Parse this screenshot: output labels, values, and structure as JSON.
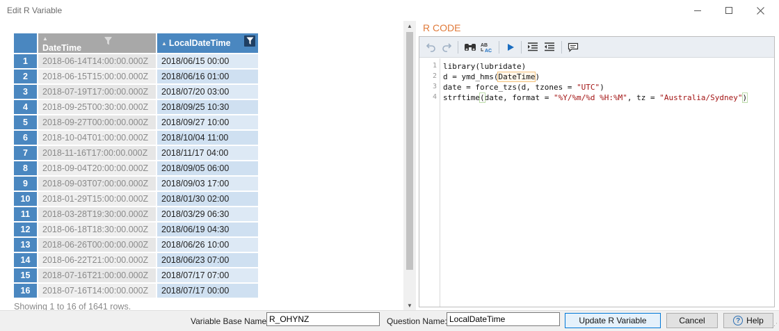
{
  "window": {
    "title": "Edit R Variable"
  },
  "table": {
    "headers": {
      "datetime": "DateTime",
      "localdatetime": "LocalDateTime"
    },
    "rows": [
      {
        "n": "1",
        "dt": "2018-06-14T14:00:00.000Z",
        "ldt": "2018/06/15 00:00"
      },
      {
        "n": "2",
        "dt": "2018-06-15T15:00:00.000Z",
        "ldt": "2018/06/16 01:00"
      },
      {
        "n": "3",
        "dt": "2018-07-19T17:00:00.000Z",
        "ldt": "2018/07/20 03:00"
      },
      {
        "n": "4",
        "dt": "2018-09-25T00:30:00.000Z",
        "ldt": "2018/09/25 10:30"
      },
      {
        "n": "5",
        "dt": "2018-09-27T00:00:00.000Z",
        "ldt": "2018/09/27 10:00"
      },
      {
        "n": "6",
        "dt": "2018-10-04T01:00:00.000Z",
        "ldt": "2018/10/04 11:00"
      },
      {
        "n": "7",
        "dt": "2018-11-16T17:00:00.000Z",
        "ldt": "2018/11/17 04:00"
      },
      {
        "n": "8",
        "dt": "2018-09-04T20:00:00.000Z",
        "ldt": "2018/09/05 06:00"
      },
      {
        "n": "9",
        "dt": "2018-09-03T07:00:00.000Z",
        "ldt": "2018/09/03 17:00"
      },
      {
        "n": "10",
        "dt": "2018-01-29T15:00:00.000Z",
        "ldt": "2018/01/30 02:00"
      },
      {
        "n": "11",
        "dt": "2018-03-28T19:30:00.000Z",
        "ldt": "2018/03/29 06:30"
      },
      {
        "n": "12",
        "dt": "2018-06-18T18:30:00.000Z",
        "ldt": "2018/06/19 04:30"
      },
      {
        "n": "13",
        "dt": "2018-06-26T00:00:00.000Z",
        "ldt": "2018/06/26 10:00"
      },
      {
        "n": "14",
        "dt": "2018-06-22T21:00:00.000Z",
        "ldt": "2018/06/23 07:00"
      },
      {
        "n": "15",
        "dt": "2018-07-16T21:00:00.000Z",
        "ldt": "2018/07/17 07:00"
      },
      {
        "n": "16",
        "dt": "2018-07-16T14:00:00.000Z",
        "ldt": "2018/07/17 00:00"
      }
    ],
    "status": "Showing 1 to 16 of 1641 rows."
  },
  "editor": {
    "label": "R CODE",
    "line_numbers": [
      "1",
      "2",
      "3",
      "4"
    ],
    "code": {
      "l1": "library(lubridate)",
      "l2_a": "d = ymd_hms(",
      "l2_b": "DateTime",
      "l2_c": ")",
      "l3_a": "date = force_tzs(d, tzones = ",
      "l3_b": "\"UTC\"",
      "l3_c": ")",
      "l4_a": "strftime",
      "l4_b": "(",
      "l4_c": "date, format = ",
      "l4_d": "\"%Y/%m/%d %H:%M\"",
      "l4_e": ", tz = ",
      "l4_f": "\"Australia/Sydney\"",
      "l4_g": ")"
    },
    "toolbar_icons": [
      "undo-icon",
      "redo-icon",
      "find-icon",
      "replace-icon",
      "run-icon",
      "indent-icon",
      "outdent-icon",
      "comment-icon"
    ]
  },
  "footer": {
    "base_name_label": "Variable Base Name:",
    "base_name_value": "R_OHYNZ",
    "question_label": "Question Name:",
    "question_value": "LocalDateTime",
    "update_label": "Update R Variable",
    "cancel_label": "Cancel",
    "help_label": "Help"
  },
  "colors": {
    "header_blue": "#4a87c0",
    "header_gray": "#a8a8a8",
    "accent_orange": "#e07a3a",
    "run_blue": "#1a6dc0"
  }
}
